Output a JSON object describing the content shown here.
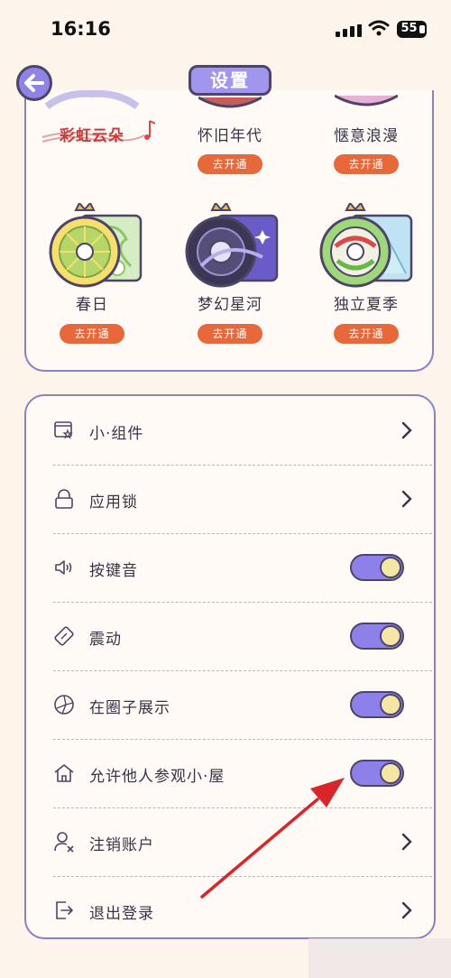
{
  "status_bar": {
    "time": "16:16",
    "battery": "55"
  },
  "header": {
    "title": "设置",
    "back_icon": "arrow-left-icon"
  },
  "skins": [
    {
      "name": "彩虹云朵",
      "icon": "rainbow-cloud-icon"
    },
    {
      "name": "怀旧年代",
      "button": "去开通",
      "icon": "nostalgia-icon"
    },
    {
      "name": "惬意浪漫",
      "button": "去开通",
      "icon": "romance-icon"
    },
    {
      "name": "春日",
      "button": "去开通",
      "icon": "spring-record-icon"
    },
    {
      "name": "梦幻星河",
      "button": "去开通",
      "icon": "galaxy-record-icon"
    },
    {
      "name": "独立夏季",
      "button": "去开通",
      "icon": "summer-record-icon"
    }
  ],
  "settings": [
    {
      "label": "小·组件",
      "icon": "widget-icon",
      "control": "chevron"
    },
    {
      "label": "应用锁",
      "icon": "lock-icon",
      "control": "chevron"
    },
    {
      "label": "按键音",
      "icon": "speaker-icon",
      "control": "toggle",
      "on": true
    },
    {
      "label": "震动",
      "icon": "vibrate-icon",
      "control": "toggle",
      "on": true
    },
    {
      "label": "在圈子展示",
      "icon": "circle-icon",
      "control": "toggle",
      "on": true
    },
    {
      "label": "允许他人参观小·屋",
      "icon": "house-icon",
      "control": "toggle",
      "on": true
    },
    {
      "label": "注销账户",
      "icon": "remove-user-icon",
      "control": "chevron"
    },
    {
      "label": "退出登录",
      "icon": "logout-icon",
      "control": "chevron"
    }
  ],
  "colors": {
    "accent": "#8d80e8",
    "button": "#e7683a",
    "toggle_knob": "#f5e6a6",
    "annotation": "#d8262b"
  }
}
